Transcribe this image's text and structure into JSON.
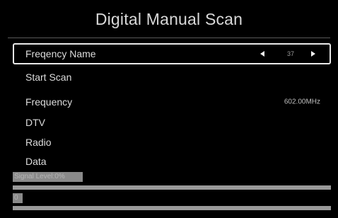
{
  "header": {
    "title": "Digital Manual Scan"
  },
  "menu": {
    "items": [
      {
        "label": "Freqency Name",
        "value": "37"
      },
      {
        "label": "Start Scan",
        "value": ""
      },
      {
        "label": "Frequency",
        "value": "602.00MHz"
      },
      {
        "label": "DTV",
        "value": ""
      },
      {
        "label": "Radio",
        "value": ""
      },
      {
        "label": "Data",
        "value": ""
      }
    ]
  },
  "signal": {
    "level_label": "Signal Level:0%",
    "level_percent": 0,
    "quality_label": "0",
    "quality_percent": 0
  },
  "colors": {
    "background": "#000000",
    "text": "#dcdcdc",
    "selection_border": "#e8e8e8",
    "bar": "#9a9a9a"
  },
  "icons": [
    "arrow-left-icon",
    "arrow-right-icon"
  ]
}
